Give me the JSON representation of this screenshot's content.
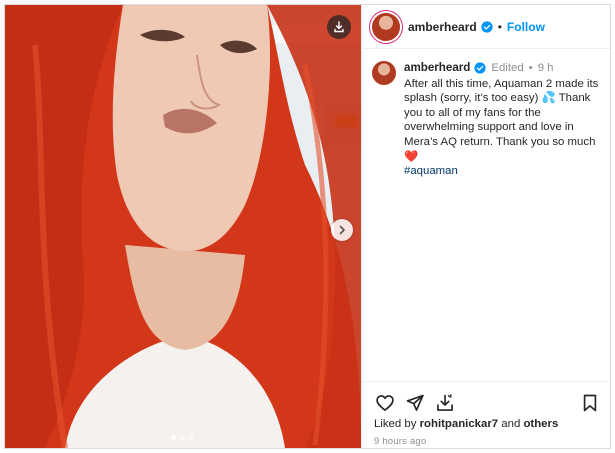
{
  "post": {
    "username": "amberheard",
    "follow_label": "Follow",
    "bullet": "•",
    "caption": {
      "username": "amberheard",
      "edited": "Edited",
      "age": "9 h",
      "text": "After all this time, Aquaman 2 made its splash (sorry, it’s too easy) 💦 Thank you to all of my fans for the overwhelming support and love in Mera’s AQ return. Thank you so much❤️",
      "hashtag": "#aquaman"
    },
    "likes": {
      "prefix": "Liked by",
      "user": "rohitpanickar7",
      "and": "and",
      "others": "others"
    },
    "timestamp": "9 hours ago"
  },
  "carousel": {
    "slides": 3,
    "active": 1
  },
  "icons": {
    "download": "download-icon",
    "next": "chevron-right-icon",
    "verified": "verified-badge-icon",
    "like": "heart-icon",
    "share": "paper-plane-icon",
    "save_download": "download-tray-icon",
    "bookmark": "bookmark-icon"
  },
  "colors": {
    "follow": "#0095f6",
    "verified": "#0095f6",
    "hashtag": "#00376b",
    "muted": "#8e8e8e"
  }
}
